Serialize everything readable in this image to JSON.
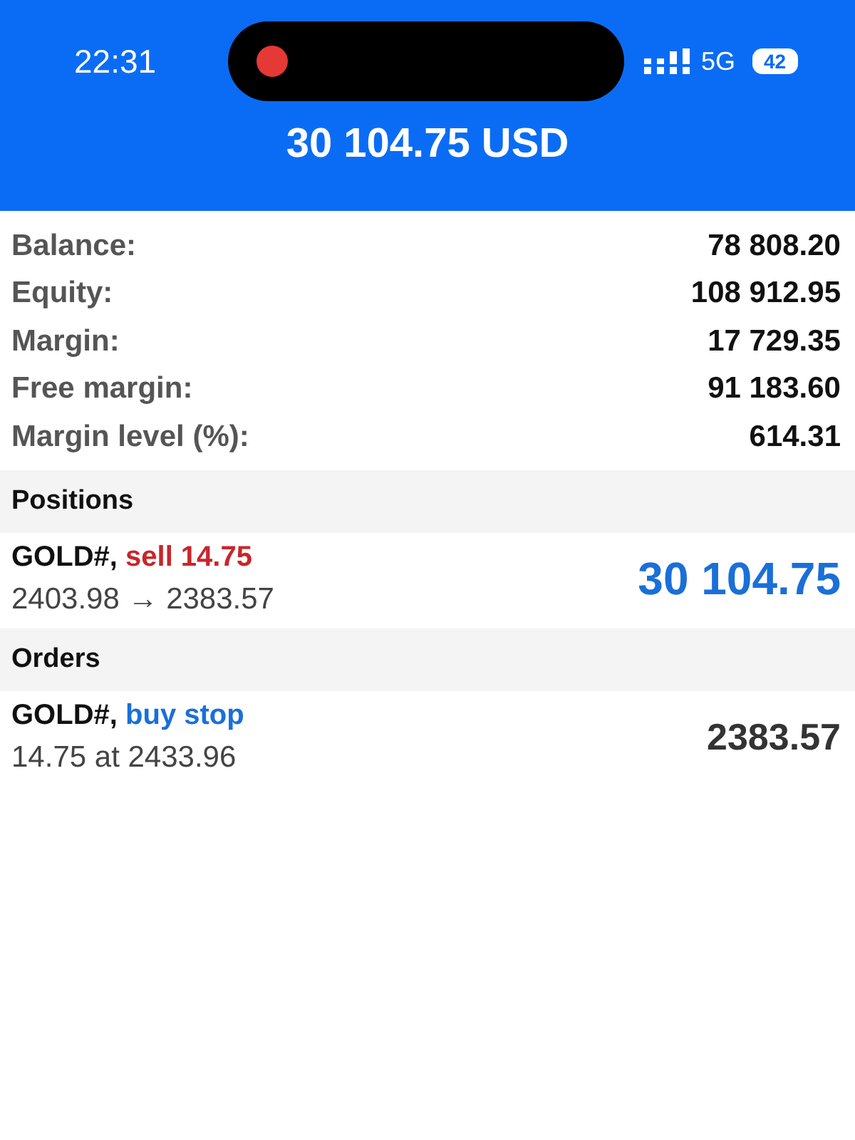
{
  "status_bar": {
    "time": "22:31",
    "network": "5G",
    "battery": "42"
  },
  "header": {
    "title": "30 104.75 USD"
  },
  "summary": [
    {
      "label": "Balance:",
      "value": "78 808.20"
    },
    {
      "label": "Equity:",
      "value": "108 912.95"
    },
    {
      "label": "Margin:",
      "value": "17 729.35"
    },
    {
      "label": "Free margin:",
      "value": "91 183.60"
    },
    {
      "label": "Margin level (%):",
      "value": "614.31"
    }
  ],
  "sections": [
    {
      "title": "Positions",
      "items": [
        {
          "symbol": "GOLD#,",
          "kind": "sell",
          "action": "sell 14.75",
          "detail": "2403.98 → 2383.57",
          "value": {
            "kind": "profit",
            "text": "30 104.75"
          }
        }
      ]
    },
    {
      "title": "Orders",
      "items": [
        {
          "symbol": "GOLD#,",
          "kind": "buy",
          "action": "buy stop",
          "detail": "14.75 at 2433.96",
          "value": {
            "kind": "plain",
            "text": "2383.57"
          }
        }
      ]
    }
  ]
}
